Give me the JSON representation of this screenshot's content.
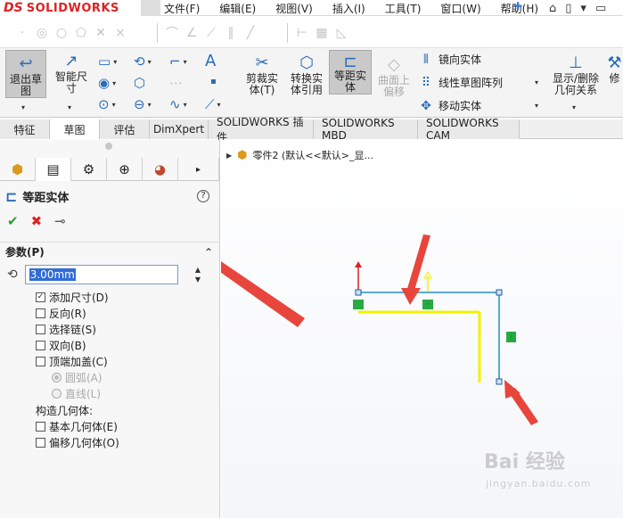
{
  "app": {
    "logo_ds": "DS",
    "logo_name": "SOLIDWORKS"
  },
  "menu": [
    "文件(F)",
    "编辑(E)",
    "视图(V)",
    "插入(I)",
    "工具(T)",
    "窗口(W)",
    "帮助(H)"
  ],
  "ribbon": {
    "exit_sketch": "退出草图",
    "smart_dimension": "智能尺寸",
    "trim": "剪裁实体(T)",
    "convert": "转换实体引用",
    "offset": "等距实体",
    "surface_offset": "曲面上偏移",
    "mirror": "镜向实体",
    "linear_pattern": "线性草图阵列",
    "move": "移动实体",
    "show_delete": "显示/删除几何关系",
    "repair": "修"
  },
  "tabs": [
    "特征",
    "草图",
    "评估",
    "DimXpert",
    "SOLIDWORKS 插件",
    "SOLIDWORKS MBD",
    "SOLIDWORKS CAM"
  ],
  "active_tab": "草图",
  "property_manager": {
    "title": "等距实体",
    "section": "参数(P)",
    "distance": "3.00mm",
    "options": [
      {
        "label": "添加尺寸(D)",
        "checked": true
      },
      {
        "label": "反向(R)",
        "checked": false
      },
      {
        "label": "选择链(S)",
        "checked": false
      },
      {
        "label": "双向(B)",
        "checked": false
      },
      {
        "label": "顶端加盖(C)",
        "checked": false
      }
    ],
    "cap_options": [
      {
        "label": "圆弧(A)",
        "selected": true
      },
      {
        "label": "直线(L)",
        "selected": false
      }
    ],
    "construct_label": "构造几何体:",
    "construct_options": [
      {
        "label": "基本几何体(E)",
        "checked": false
      },
      {
        "label": "偏移几何体(O)",
        "checked": false
      }
    ]
  },
  "feature_tree": {
    "part_label": "零件2 (默认<<默认>_显..."
  },
  "watermark": {
    "text": "Bai 经验",
    "sub": "jingyan.baidu.com"
  },
  "colors": {
    "accent": "#2a6bb8",
    "offset_preview": "#f2f200",
    "annotation_arrow": "#e8453c",
    "sketch_line": "#1f8fc7"
  }
}
